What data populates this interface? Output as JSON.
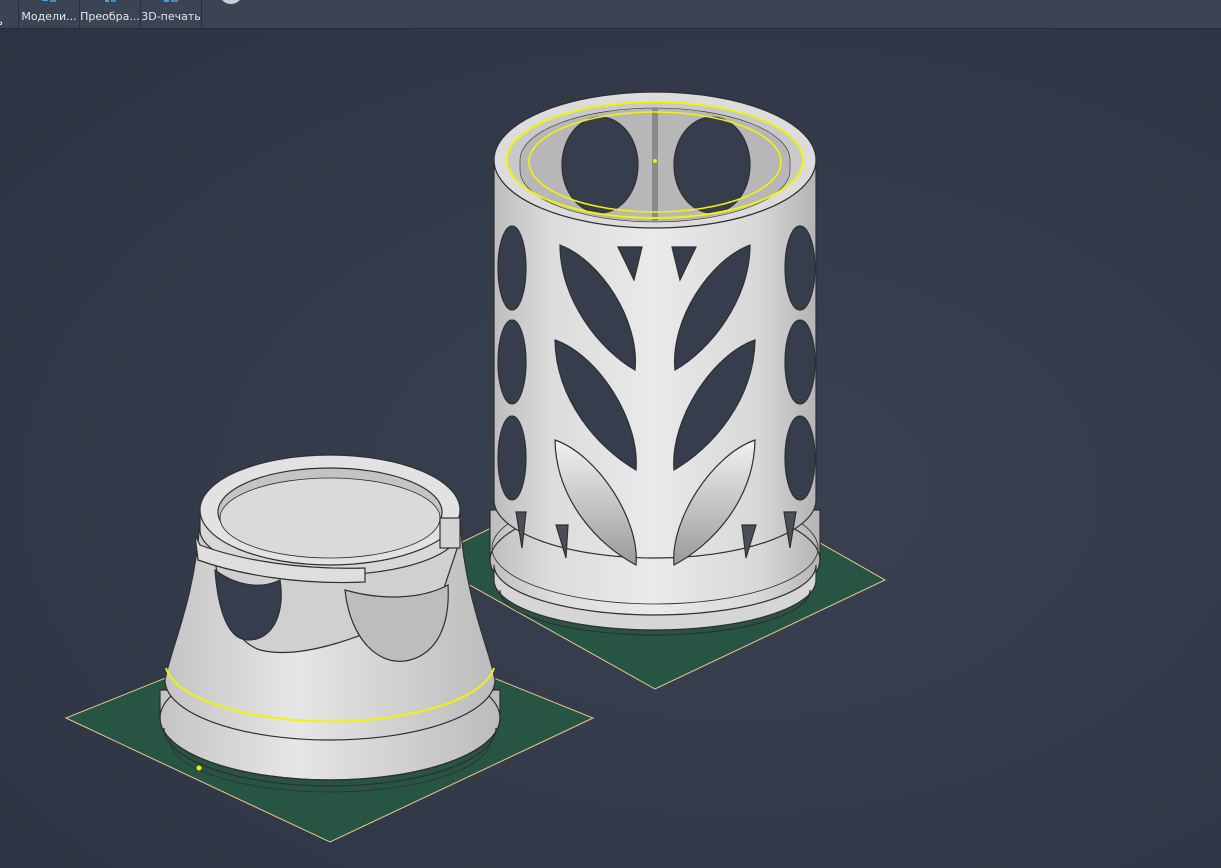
{
  "toolbar": {
    "items": [
      {
        "label": "ть",
        "icon": "cut-off-tool-icon"
      },
      {
        "label": "Модели...",
        "icon": "modeling-icon"
      },
      {
        "label": "Преобра...",
        "icon": "transform-icon"
      },
      {
        "label": "3D-печать",
        "icon": "3d-print-icon"
      }
    ],
    "extra_icon": "circle-tool-icon"
  },
  "viewport": {
    "objects": [
      "base-part",
      "lattice-cylinder"
    ],
    "colors": {
      "background": "#323a4a",
      "plate": "#275443",
      "plate_edge": "#e7c98d",
      "selection": "#f2f20a",
      "model": "#e1e1e1"
    }
  }
}
